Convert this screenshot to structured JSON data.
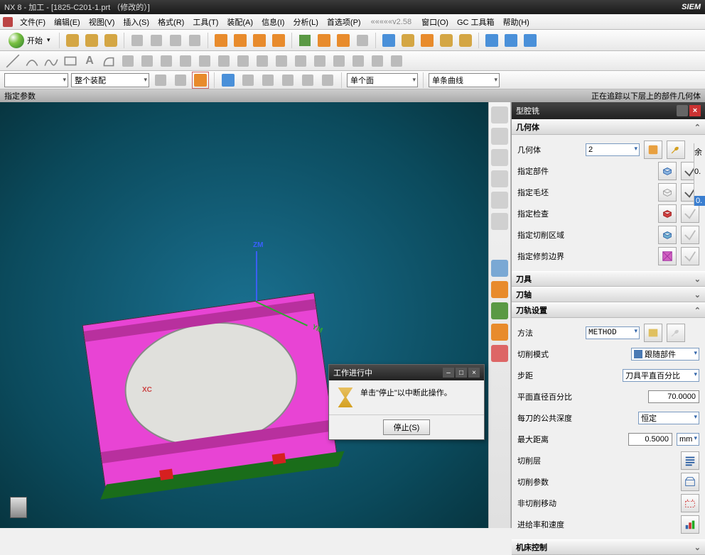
{
  "titlebar": {
    "text": "NX 8 - 加工 - [1825-C201-1.prt （修改的）]",
    "brand": "SIEM"
  },
  "menu": {
    "items": [
      "文件(F)",
      "编辑(E)",
      "视图(V)",
      "插入(S)",
      "格式(R)",
      "工具(T)",
      "装配(A)",
      "信息(I)",
      "分析(L)",
      "首选项(P)"
    ],
    "ver": "«««««v2.58",
    "items2": [
      "窗口(O)",
      "GC 工具箱",
      "帮助(H)"
    ]
  },
  "toolbar1": {
    "start": "开始"
  },
  "filterbar": {
    "combo1": "整个装配",
    "combo2": "单个面",
    "combo3": "单条曲线"
  },
  "status": {
    "left": "指定参数",
    "right": "正在追踪以下层上的部件几何体"
  },
  "panel": {
    "title": "型腔铣",
    "geom": {
      "header": "几何体",
      "body_label": "几何体",
      "body_val": "2",
      "part": "指定部件",
      "blank": "指定毛坯",
      "check": "指定检查",
      "cutarea": "指定切削区域",
      "trim": "指定修剪边界"
    },
    "tool": "刀具",
    "axis": "刀轴",
    "path": {
      "header": "刀轨设置",
      "method_l": "方法",
      "method_v": "METHOD",
      "cutmode_l": "切削模式",
      "cutmode_v": "跟随部件",
      "step_l": "步距",
      "step_v": "刀具平直百分比",
      "pct_l": "平面直径百分比",
      "pct_v": "70.0000",
      "depth_l": "每刀的公共深度",
      "depth_v": "恒定",
      "maxd_l": "最大距离",
      "maxd_v": "0.5000",
      "maxd_u": "mm",
      "cutlevel": "切削层",
      "cutparam": "切削参数",
      "noncut": "非切削移动",
      "feed": "进给率和速度"
    },
    "machine": "机床控制"
  },
  "modal": {
    "title": "工作进行中",
    "msg": "单击\"停止\"以中断此操作。",
    "stop": "停止(S)"
  },
  "clipright": {
    "t1": "余",
    "t2": "0.",
    "t3": "0."
  },
  "axes": {
    "xc": "XC"
  }
}
